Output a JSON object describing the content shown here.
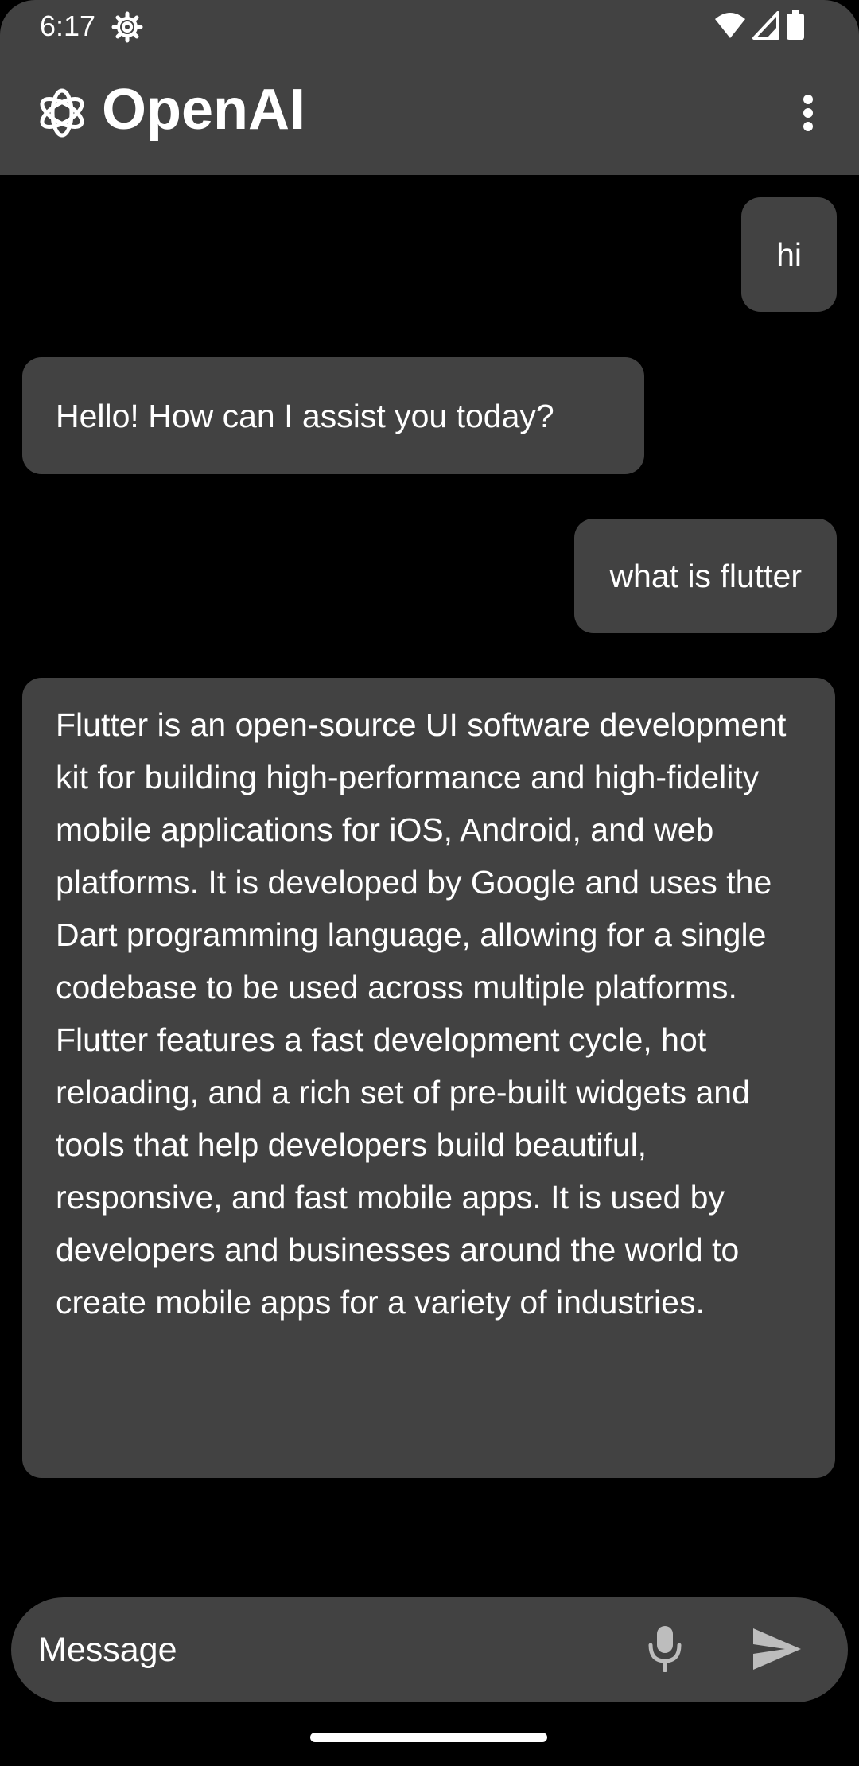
{
  "status_bar": {
    "time": "6:17",
    "icons": [
      "settings-gear-icon",
      "wifi-icon",
      "cellular-signal-icon",
      "battery-icon"
    ]
  },
  "app_bar": {
    "title": "OpenAI",
    "logo_icon": "openai-logo-icon",
    "menu_icon": "more-vertical-icon"
  },
  "chat": {
    "messages": [
      {
        "role": "user",
        "text": "hi"
      },
      {
        "role": "assistant",
        "text": "Hello! How can I assist you today?"
      },
      {
        "role": "user",
        "text": "what is flutter"
      },
      {
        "role": "assistant",
        "text": "Flutter is an open-source UI software development kit for building high-performance and high-fidelity mobile applications for iOS, Android, and web platforms. It is developed by Google and uses the Dart programming language, allowing for a single codebase to be used across multiple platforms. Flutter features a fast development cycle, hot reloading, and a rich set of pre-built widgets and tools that help developers build beautiful, responsive, and fast mobile apps. It is used by developers and businesses around the world to create mobile apps for a variety of industries."
      }
    ]
  },
  "input": {
    "placeholder": "Message",
    "value": "",
    "mic_icon": "microphone-icon",
    "send_icon": "send-icon"
  },
  "colors": {
    "background": "#000000",
    "surface": "#424242",
    "text": "#ffffff",
    "icon_muted": "#bdbdbd"
  }
}
